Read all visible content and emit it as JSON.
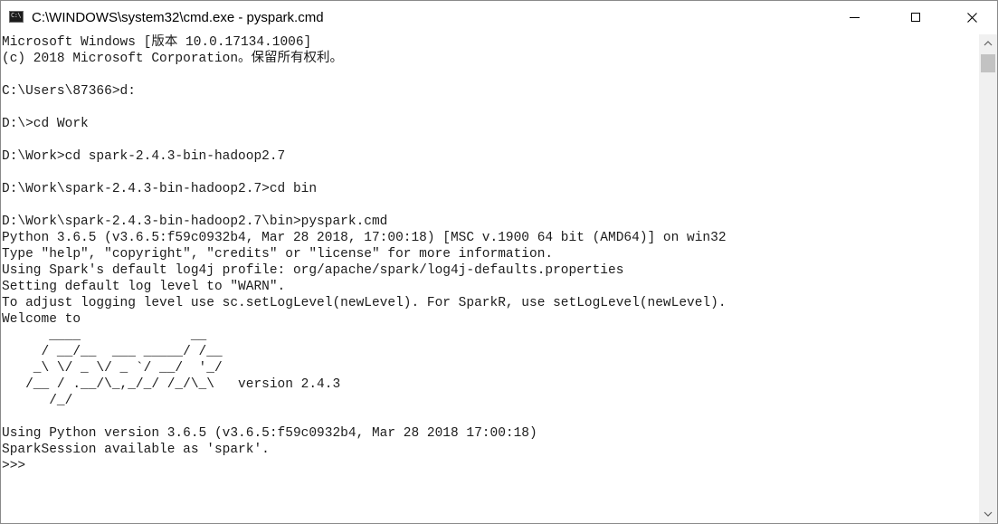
{
  "window": {
    "icon_label": "C:\\",
    "title": "C:\\WINDOWS\\system32\\cmd.exe - pyspark.cmd"
  },
  "console": {
    "lines": [
      "Microsoft Windows [版本 10.0.17134.1006]",
      "(c) 2018 Microsoft Corporation。保留所有权利。",
      "",
      "C:\\Users\\87366>d:",
      "",
      "D:\\>cd Work",
      "",
      "D:\\Work>cd spark-2.4.3-bin-hadoop2.7",
      "",
      "D:\\Work\\spark-2.4.3-bin-hadoop2.7>cd bin",
      "",
      "D:\\Work\\spark-2.4.3-bin-hadoop2.7\\bin>pyspark.cmd",
      "Python 3.6.5 (v3.6.5:f59c0932b4, Mar 28 2018, 17:00:18) [MSC v.1900 64 bit (AMD64)] on win32",
      "Type \"help\", \"copyright\", \"credits\" or \"license\" for more information.",
      "Using Spark's default log4j profile: org/apache/spark/log4j-defaults.properties",
      "Setting default log level to \"WARN\".",
      "To adjust logging level use sc.setLogLevel(newLevel). For SparkR, use setLogLevel(newLevel).",
      "Welcome to",
      "      ____              __",
      "     / __/__  ___ _____/ /__",
      "    _\\ \\/ _ \\/ _ `/ __/  '_/",
      "   /__ / .__/\\_,_/_/ /_/\\_\\   version 2.4.3",
      "      /_/",
      "",
      "Using Python version 3.6.5 (v3.6.5:f59c0932b4, Mar 28 2018 17:00:18)",
      "SparkSession available as 'spark'.",
      ">>>"
    ]
  },
  "colors": {
    "console_background": "#ffffff",
    "console_text": "#1c1c1c",
    "scrollbar_track": "#f0f0f0",
    "scrollbar_thumb": "#c2c2c2"
  },
  "icons": {
    "app": "cmd-console-icon",
    "minimize": "minimize-icon",
    "maximize": "maximize-icon",
    "close": "close-icon",
    "scroll_up": "chevron-up-icon",
    "scroll_down": "chevron-down-icon"
  }
}
